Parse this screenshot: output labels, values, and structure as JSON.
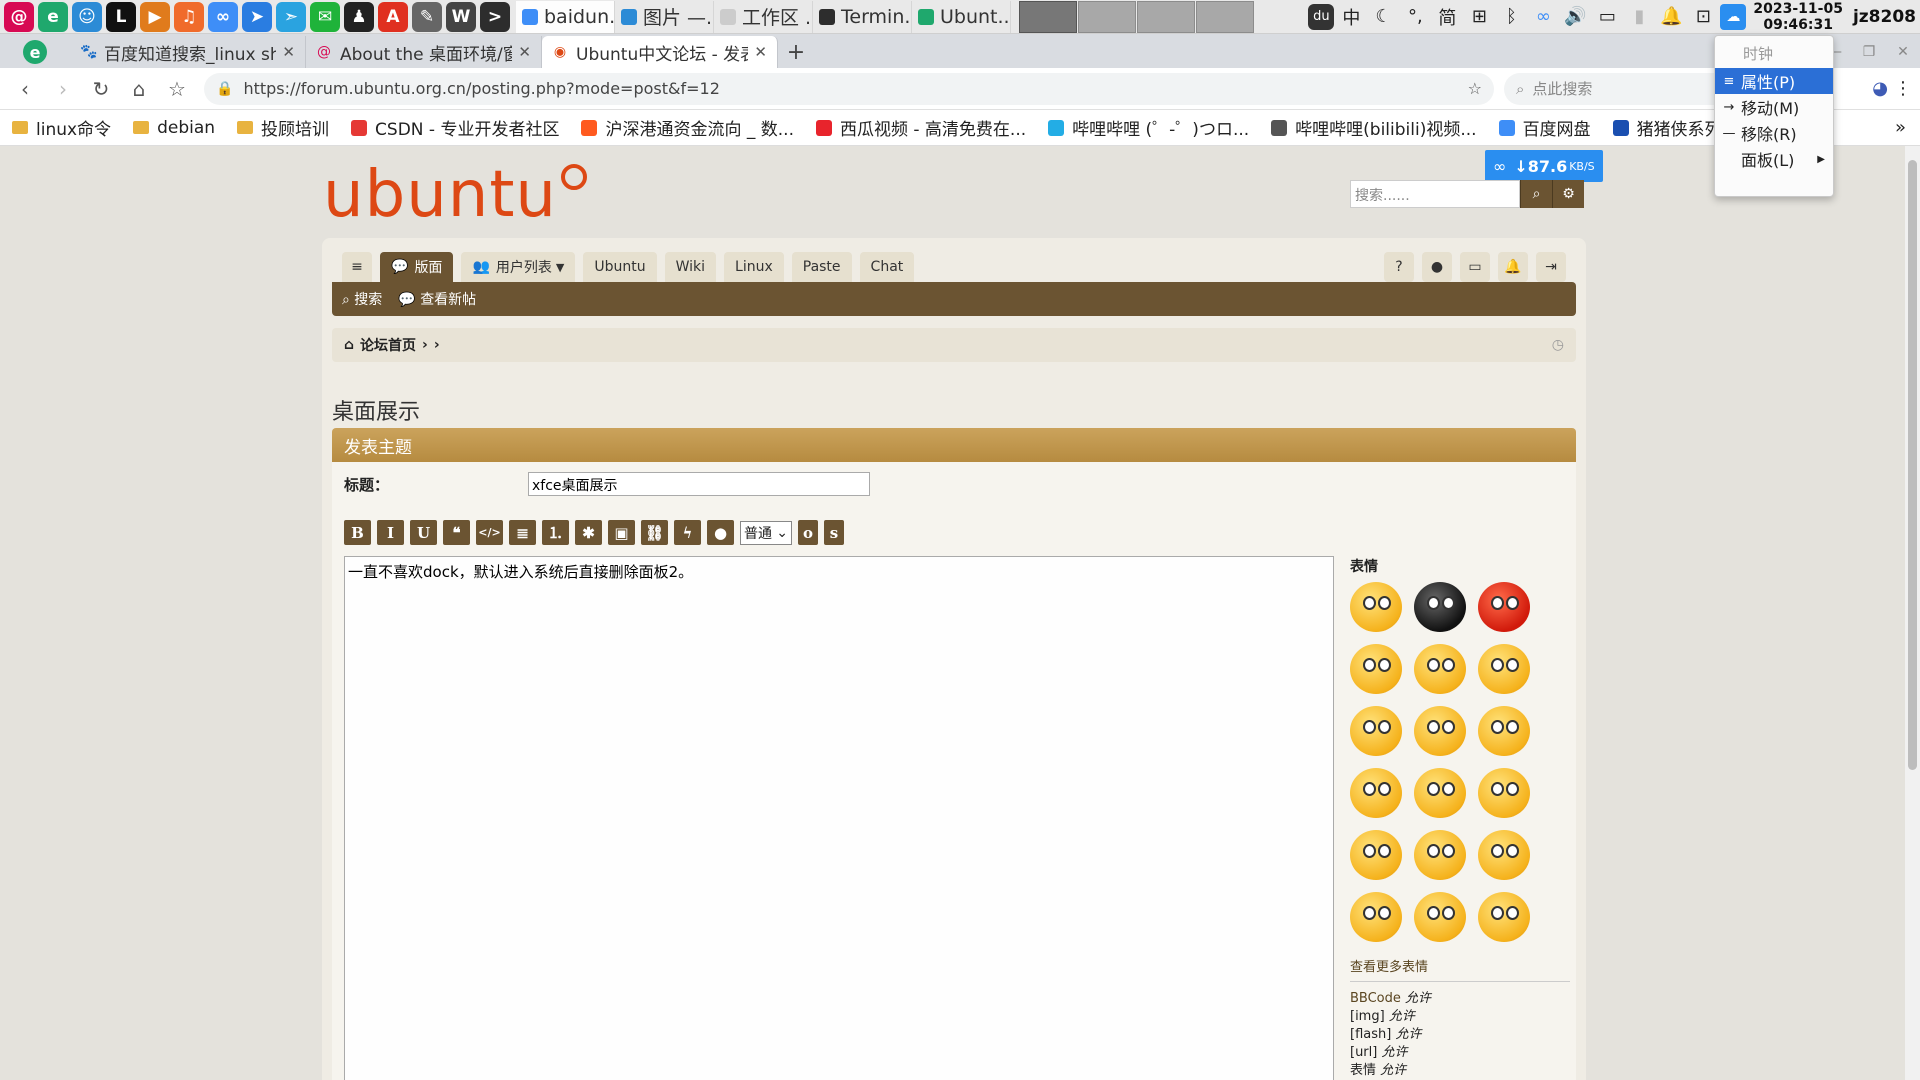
{
  "panel": {
    "launchers": [
      {
        "name": "debian-menu-icon",
        "color": "#d70a53",
        "glyph": "@"
      },
      {
        "name": "edge-browser-icon",
        "color": "#1fa86d",
        "glyph": "e"
      },
      {
        "name": "file-manager-icon",
        "color": "#2c8bd6",
        "glyph": "☺"
      },
      {
        "name": "editor-icon",
        "color": "#111111",
        "glyph": "L"
      },
      {
        "name": "video-player-icon",
        "color": "#e07b1c",
        "glyph": "▶"
      },
      {
        "name": "music-icon",
        "color": "#f06b2b",
        "glyph": "♫"
      },
      {
        "name": "cloud-drive-icon",
        "color": "#3e8ef7",
        "glyph": "∞"
      },
      {
        "name": "kite-icon",
        "color": "#2a7de1",
        "glyph": "➤"
      },
      {
        "name": "telegram-icon",
        "color": "#2aa3e0",
        "glyph": "➣"
      },
      {
        "name": "wechat-icon",
        "color": "#1fb33a",
        "glyph": "✉"
      },
      {
        "name": "qq-icon",
        "color": "#222222",
        "glyph": "♟"
      },
      {
        "name": "pdf-icon",
        "color": "#e03020",
        "glyph": "A"
      },
      {
        "name": "notes-icon",
        "color": "#666666",
        "glyph": "✎"
      },
      {
        "name": "wordpress-icon",
        "color": "#444444",
        "glyph": "W"
      },
      {
        "name": "terminal-icon",
        "color": "#2d2d2d",
        "glyph": ">"
      }
    ],
    "tasks": [
      {
        "label": "baidun...",
        "color": "#3e8ef7",
        "active": true
      },
      {
        "label": "图片 —...",
        "color": "#2c8bd6",
        "active": false
      },
      {
        "label": "工作区 ...",
        "color": "#cccccc",
        "active": false
      },
      {
        "label": "Termin...",
        "color": "#2d2d2d",
        "active": false
      },
      {
        "label": "Ubunt...",
        "color": "#1fa86d",
        "active": false
      }
    ],
    "tray": {
      "input_method": "中",
      "moon": "☾",
      "punct": "°,",
      "simplified": "简",
      "grid": "⊞",
      "bluetooth": "ᛒ",
      "cloud": "∞",
      "volume": "🔊",
      "battery": "▭",
      "bell": "🔔",
      "screenshot": "⊡"
    },
    "clock_date": "2023-11-05",
    "clock_time": "09:46:31",
    "user": "jz8208"
  },
  "tabs": [
    {
      "label": "百度知道搜索_linux shell",
      "active": false,
      "fav": "🐾",
      "favcolor": "#2932e1"
    },
    {
      "label": "About the 桌面环境/窗口",
      "active": false,
      "fav": "@",
      "favcolor": "#d70a53"
    },
    {
      "label": "Ubuntu中文论坛 - 发表",
      "active": true,
      "fav": "◉",
      "favcolor": "#dd4814"
    }
  ],
  "nav": {
    "url": "https://forum.ubuntu.org.cn/posting.php?mode=post&f=12",
    "search_placeholder": "点此搜索"
  },
  "bookmarks": [
    {
      "label": "linux命令",
      "type": "folder"
    },
    {
      "label": "debian",
      "type": "folder"
    },
    {
      "label": "投顾培训",
      "type": "folder"
    },
    {
      "label": "CSDN - 专业开发者社区",
      "type": "site",
      "color": "#e53935"
    },
    {
      "label": "沪深港通资金流向 _ 数...",
      "type": "site",
      "color": "#ff5a1f"
    },
    {
      "label": "西瓜视频 - 高清免费在...",
      "type": "site",
      "color": "#e8242c"
    },
    {
      "label": "哔哩哔哩 (゜-゜)つロ...",
      "type": "site",
      "color": "#23ade5"
    },
    {
      "label": "哔哩哔哩(bilibili)视频...",
      "type": "site",
      "color": "#555555"
    },
    {
      "label": "百度网盘",
      "type": "site",
      "color": "#3e8ef7"
    },
    {
      "label": "猪猪侠系列动漫全集",
      "type": "site",
      "color": "#1a4fb0"
    }
  ],
  "speed": {
    "value": "↓87.6",
    "unit": "KB/S"
  },
  "site": {
    "logo": "ubuntu",
    "search_placeholder": "搜索......",
    "nav_tabs": [
      "版面",
      "用户列表",
      "Ubuntu",
      "Wiki",
      "Linux",
      "Paste",
      "Chat"
    ],
    "sub_links": [
      "搜索",
      "查看新帖"
    ],
    "breadcrumb": "论坛首页",
    "forum_title": "桌面展示",
    "panel_header": "发表主题",
    "title_label": "标题：",
    "subject_value": "xfce桌面展示",
    "font_size_select": "普通",
    "toolbar": [
      "B",
      "I",
      "U",
      "❝",
      "</>",
      "≣",
      "⒈",
      "✱",
      "▣",
      "⛓",
      "ϟ",
      "●"
    ],
    "toolbar_extra": [
      "o",
      "s"
    ],
    "editor_text": "一直不喜欢dock，默认进入系统后直接删除面板2。",
    "smileys_head": "表情",
    "smileys_more": "查看更多表情",
    "bbcode": [
      {
        "k": "BBCode",
        "v": "允许"
      },
      {
        "k": "[img]",
        "v": "允许"
      },
      {
        "k": "[flash]",
        "v": "允许"
      },
      {
        "k": "[url]",
        "v": "允许"
      },
      {
        "k": "表情",
        "v": "允许"
      }
    ]
  },
  "context_menu": {
    "title": "时钟",
    "items": [
      {
        "label": "属性(P)",
        "icon": "≡",
        "highlight": true,
        "submenu": false
      },
      {
        "label": "移动(M)",
        "icon": "→",
        "highlight": false,
        "submenu": false
      },
      {
        "label": "移除(R)",
        "icon": "—",
        "highlight": false,
        "submenu": false
      },
      {
        "label": "面板(L)",
        "icon": "",
        "highlight": false,
        "submenu": true
      }
    ]
  }
}
